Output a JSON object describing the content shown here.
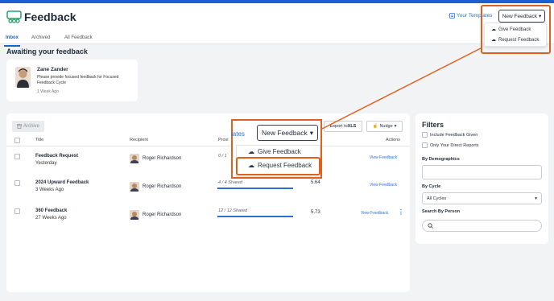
{
  "app": {
    "title": "Feedback",
    "your_templates": "Your Templates",
    "new_feedback": "New Feedback"
  },
  "tabs": [
    {
      "label": "Inbox"
    },
    {
      "label": "Archived"
    },
    {
      "label": "All Feedback"
    }
  ],
  "awaiting": {
    "title": "Awaiting your feedback",
    "card": {
      "name": "Zane Zander",
      "message": "Please provide focused feedback for Focused Feedback Cycle",
      "time": "1 Week Ago"
    }
  },
  "toolbar": {
    "archive": "Archive",
    "export_prefix": "Export to ",
    "export_format": "XLS",
    "nudge": "Nudge"
  },
  "table": {
    "headers": {
      "title": "Title",
      "recipient": "Recipient",
      "provider": "Provi",
      "actions": "Actions"
    },
    "rows": [
      {
        "title": "Feedback Request",
        "sub": "Yesterday",
        "recipient": "Roger Richardson",
        "progress": "0 / 1",
        "score": "",
        "action": "View Feedback"
      },
      {
        "title": "2024 Upward Feedback",
        "sub": "3 Weeks Ago",
        "recipient": "Roger Richardson",
        "progress": "4 / 4 Shared",
        "score": "5.64",
        "action": "View Feedback"
      },
      {
        "title": "360 Feedback",
        "sub": "27 Weeks Ago",
        "recipient": "Roger Richardson",
        "progress": "12 / 12 Shared",
        "score": "5.73",
        "action": "View Feedback"
      }
    ]
  },
  "filters": {
    "title": "Filters",
    "include_given": "Include Feedback Given",
    "only_direct": "Only Your Direct Reports",
    "by_demographics": "By Demographics",
    "by_cycle": "By Cycle",
    "cycle_value": "All Cycles",
    "search_person": "Search By Person"
  },
  "dropdown": {
    "give": "Give Feedback",
    "request": "Request Feedback"
  },
  "zoom": {
    "templates_fragment": "lates",
    "new_feedback": "New Feedback",
    "give": "Give Feedback",
    "request": "Request Feedback"
  },
  "colors": {
    "accent": "#1c5fcf",
    "highlight": "#e0601d",
    "link": "#2b6fd6"
  }
}
